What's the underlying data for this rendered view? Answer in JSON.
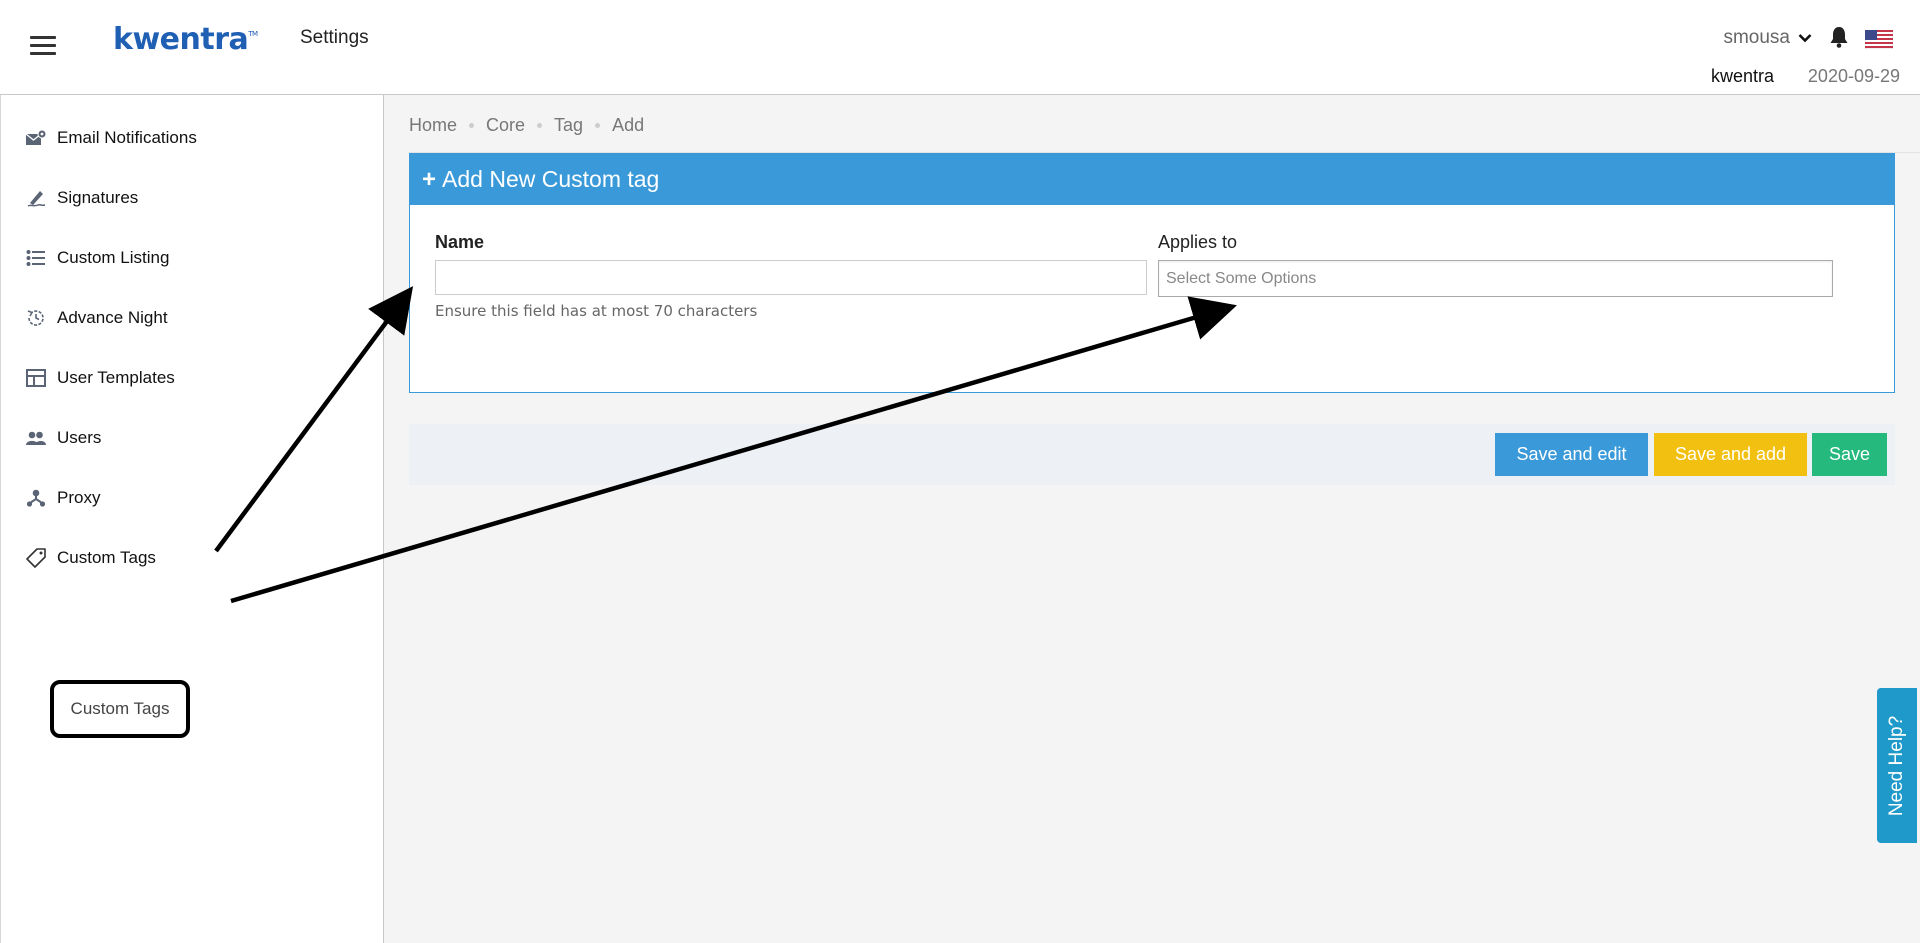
{
  "header": {
    "brand": "kwentra",
    "brand_tm": "TM",
    "page_title": "Settings",
    "username": "smousa",
    "org": "kwentra",
    "date": "2020-09-29"
  },
  "sidebar": {
    "items": [
      {
        "label": "Email Notifications",
        "icon": "envelope-gear-icon"
      },
      {
        "label": "Signatures",
        "icon": "signature-pen-icon"
      },
      {
        "label": "Custom Listing",
        "icon": "list-icon"
      },
      {
        "label": "Advance Night",
        "icon": "clock-refresh-icon"
      },
      {
        "label": "User Templates",
        "icon": "layout-template-icon"
      },
      {
        "label": "Users",
        "icon": "users-icon"
      },
      {
        "label": "Proxy",
        "icon": "proxy-nodes-icon"
      },
      {
        "label": "Custom Tags",
        "icon": "tag-icon"
      }
    ],
    "sub_item": "Custom Tags"
  },
  "breadcrumb": [
    "Home",
    "Core",
    "Tag",
    "Add"
  ],
  "form": {
    "title": "Add New Custom tag",
    "name_label": "Name",
    "name_value": "",
    "name_help": "Ensure this field has at most 70 characters",
    "applies_label": "Applies to",
    "applies_placeholder": "Select Some Options"
  },
  "actions": {
    "save_edit": "Save and edit",
    "save_add": "Save and add",
    "save": "Save"
  },
  "help_tab": "Need Help?",
  "colors": {
    "brand": "#1f5fb4",
    "panel_header": "#3a99d9",
    "save_edit": "#3a99d9",
    "save_add": "#f2c010",
    "save": "#26b97e",
    "help_tab": "#1e99c9"
  }
}
